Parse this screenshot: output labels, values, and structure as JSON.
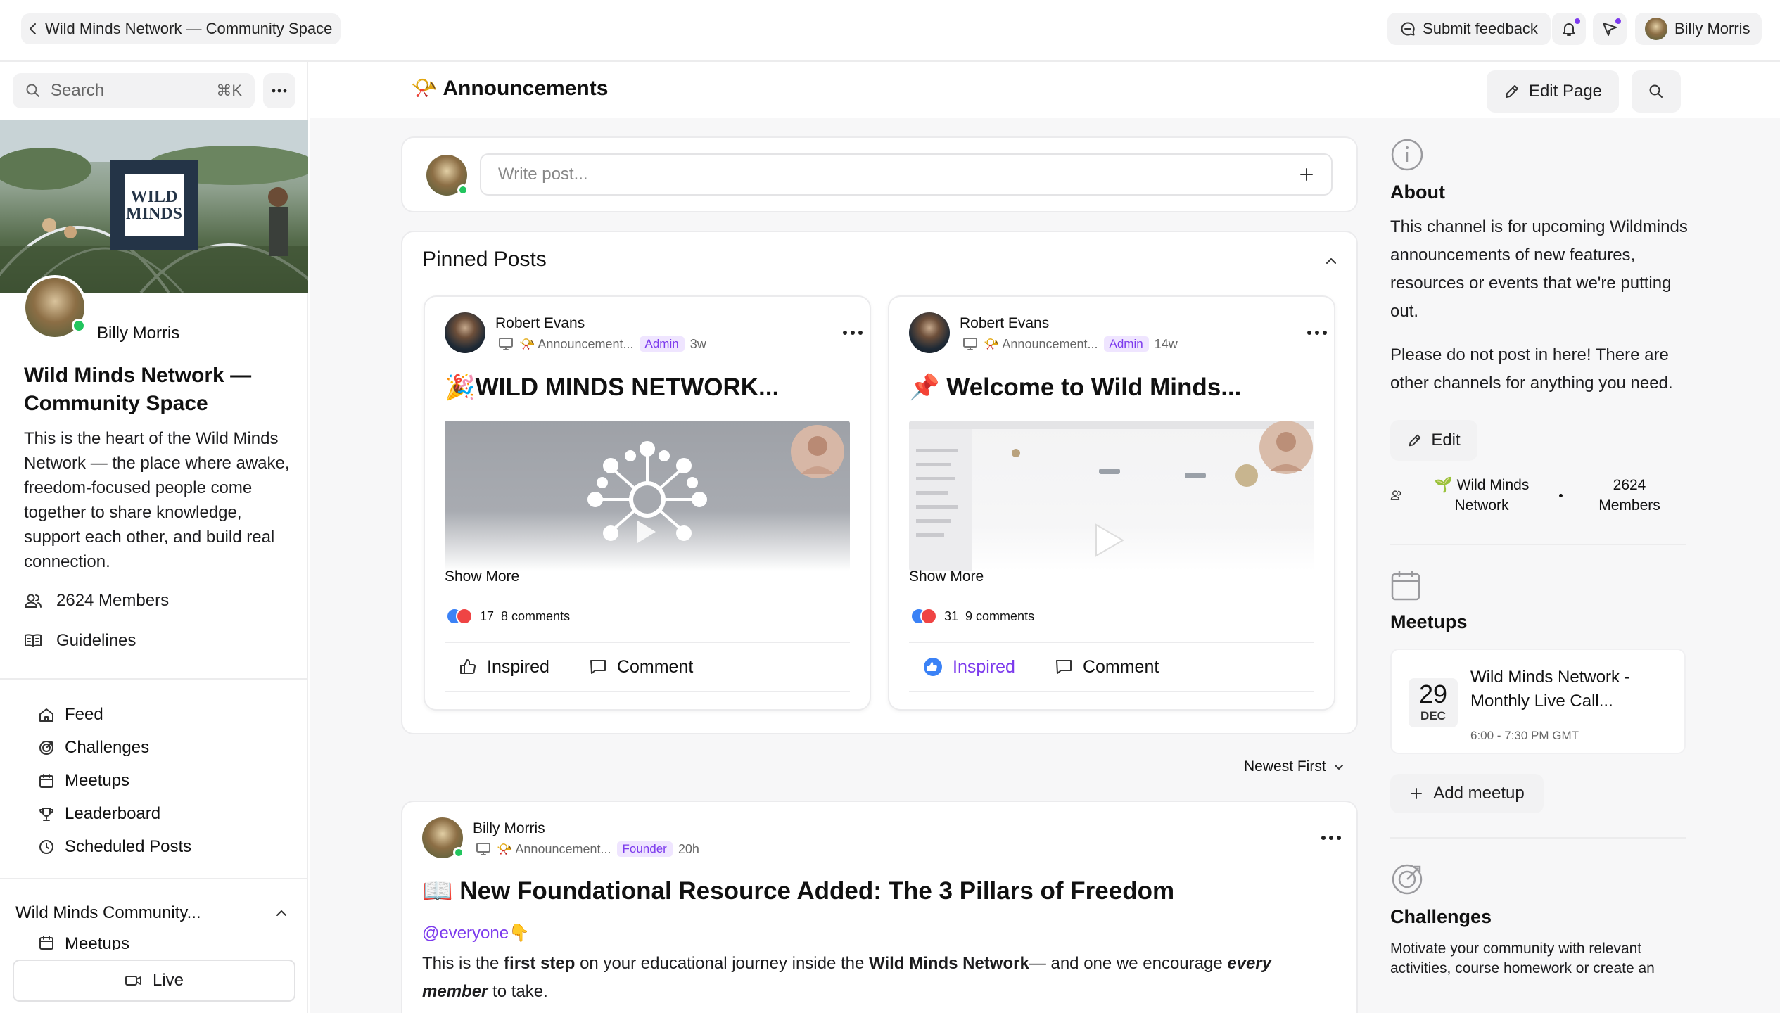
{
  "topbar": {
    "back_label": "Wild Minds Network — Community Space",
    "feedback_label": "Submit feedback",
    "user_name": "Billy Morris"
  },
  "sidebar": {
    "search_placeholder": "Search",
    "search_shortcut": "⌘K",
    "logo_text": [
      "WILD",
      "MINDS"
    ],
    "owner_name": "Billy Morris",
    "community_title": "Wild Minds Network — Community Space",
    "community_description": "This is the heart of the Wild Minds Network — the place where awake, freedom-focused people come together to share knowledge, support each other, and build real connection.",
    "members_label": "2624 Members",
    "guidelines_label": "Guidelines",
    "nav": [
      {
        "label": "Feed",
        "icon": "home-icon"
      },
      {
        "label": "Challenges",
        "icon": "target-icon"
      },
      {
        "label": "Meetups",
        "icon": "calendar-icon"
      },
      {
        "label": "Leaderboard",
        "icon": "trophy-icon"
      },
      {
        "label": "Scheduled Posts",
        "icon": "clock-icon"
      }
    ],
    "section_title": "Wild Minds Community...",
    "section_items": [
      "Meetups"
    ],
    "live_label": "Live"
  },
  "page": {
    "title": "Announcements",
    "title_emoji": "📯",
    "edit_page_label": "Edit Page",
    "composer_placeholder": "Write post...",
    "pinned_title": "Pinned Posts",
    "sort_label": "Newest First"
  },
  "pinned_posts": [
    {
      "author": "Robert Evans",
      "channel": "📯 Announcement...",
      "role": "Admin",
      "age": "3w",
      "title": "🎉WILD MINDS NETWORK...",
      "show_more": "Show More",
      "reaction_count": "17",
      "comments": "8 comments",
      "inspired_label": "Inspired",
      "inspired_active": false,
      "comment_label": "Comment"
    },
    {
      "author": "Robert Evans",
      "channel": "📯 Announcement...",
      "role": "Admin",
      "age": "14w",
      "title": "📌 Welcome to Wild Minds...",
      "show_more": "Show More",
      "reaction_count": "31",
      "comments": "9 comments",
      "inspired_label": "Inspired",
      "inspired_active": true,
      "comment_label": "Comment"
    }
  ],
  "post": {
    "author": "Billy Morris",
    "channel": "📯 Announcement...",
    "role": "Founder",
    "age": "20h",
    "title": "📖 New Foundational Resource Added: The 3 Pillars of Freedom",
    "mention": "@everyone",
    "mention_emoji": "👇",
    "body_parts": [
      {
        "text": "This is the ",
        "style": "normal"
      },
      {
        "text": "first step",
        "style": "bold"
      },
      {
        "text": " on your educational journey inside the ",
        "style": "normal"
      },
      {
        "text": "Wild Minds Network",
        "style": "bold"
      },
      {
        "text": "— and one we encourage ",
        "style": "normal"
      },
      {
        "text": "every member",
        "style": "bolditalic"
      },
      {
        "text": " to take.",
        "style": "normal"
      }
    ]
  },
  "about": {
    "title": "About",
    "p1": "This channel is for upcoming Wildminds announcements of new features, resources or events that we're putting out.",
    "p2": "Please do not post in here! There are other channels for anything you need.",
    "edit_label": "Edit",
    "network_label": "🌱 Wild Minds Network",
    "members_label": "2624 Members"
  },
  "meetups": {
    "title": "Meetups",
    "event": {
      "day": "29",
      "month": "DEC",
      "title": "Wild Minds Network - Monthly Live Call...",
      "time": "6:00 - 7:30 PM GMT"
    },
    "add_label": "Add meetup"
  },
  "challenges": {
    "title": "Challenges",
    "description": "Motivate your community with relevant activities, course homework or create an"
  },
  "colors": {
    "accent": "#7c3aed",
    "inspired_active": "#3b82f6",
    "online": "#22c55e"
  }
}
